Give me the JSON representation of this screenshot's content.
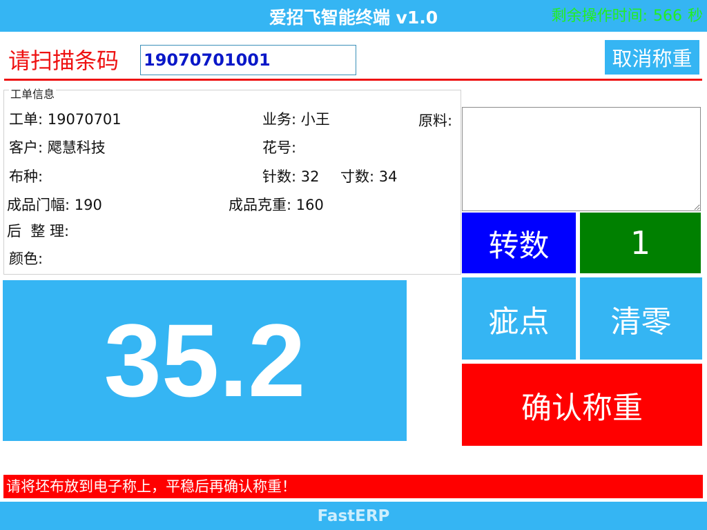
{
  "title_bar": {
    "title": "爱招飞智能终端 v1.0",
    "countdown_label": "剩余操作时间:",
    "countdown_value": "566",
    "countdown_unit": "秒"
  },
  "scan": {
    "label": "请扫描条码",
    "value": "19070701001"
  },
  "cancel_weigh_label": "取消称重",
  "info": {
    "legend": "工单信息",
    "work_order_label": "工单:",
    "work_order": "19070701",
    "salesman_label": "业务:",
    "salesman": "小王",
    "material_label": "原料:",
    "customer_label": "客户:",
    "customer": "飔慧科技",
    "pattern_label": "花号:",
    "pattern": "",
    "fabric_label": "布种:",
    "fabric": "",
    "needles_label": "针数:",
    "needles": "32",
    "gauge_label": "寸数:",
    "gauge": "34",
    "width_label": "成品门幅:",
    "width": "190",
    "gsm_label": "成品克重:",
    "gsm": "160",
    "finishing_label": "后  整 理:",
    "finishing": "",
    "color_label": "颜色:",
    "color": ""
  },
  "weight": {
    "value": "35.2"
  },
  "turns": {
    "label": "转数",
    "value": "1"
  },
  "defect_label": "疵点",
  "zero_label": "清零",
  "confirm_label": "确认称重",
  "status_message": "请将坯布放到电子称上，平稳后再确认称重！",
  "footer_text": "FastERP",
  "colors": {
    "accent": "#35b5f3",
    "alert": "#ff0000",
    "turns_label_bg": "#0000ff",
    "turns_value_bg": "#008000",
    "countdown": "#22ee22",
    "scan_value": "#0a18c8"
  }
}
